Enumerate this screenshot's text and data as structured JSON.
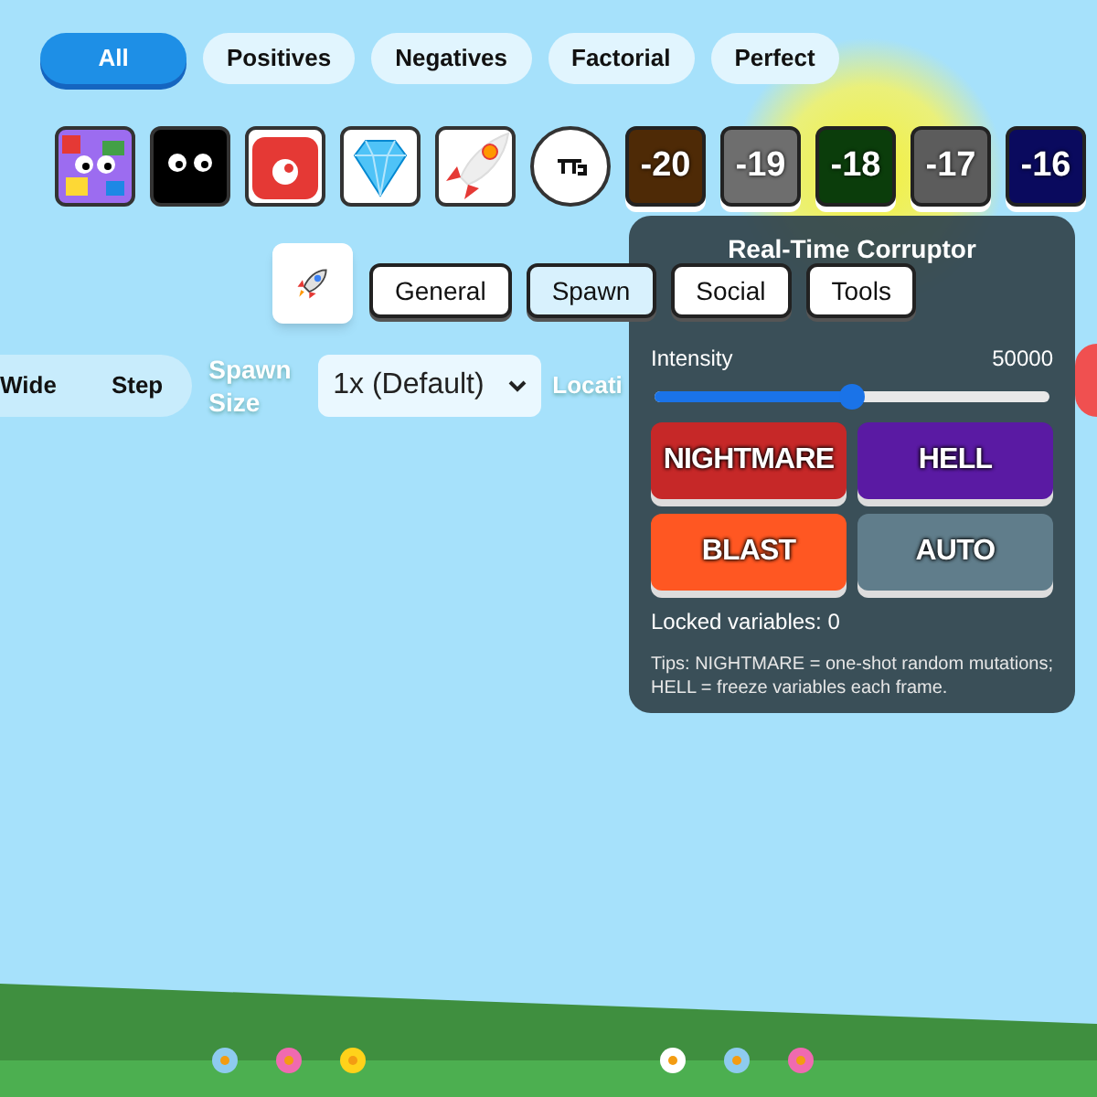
{
  "filters": [
    {
      "label": "All",
      "selected": true
    },
    {
      "label": "Positives",
      "selected": false
    },
    {
      "label": "Negatives",
      "selected": false
    },
    {
      "label": "Factorial",
      "selected": false
    },
    {
      "label": "Perfect",
      "selected": false
    }
  ],
  "items": [
    {
      "kind": "sprite"
    },
    {
      "kind": "sprite"
    },
    {
      "kind": "sprite"
    },
    {
      "kind": "sprite"
    },
    {
      "kind": "sprite"
    },
    {
      "kind": "symbol"
    },
    {
      "kind": "number",
      "label": "-20",
      "color": "#4e2a06"
    },
    {
      "kind": "number",
      "label": "-19",
      "color": "#6e6e6e"
    },
    {
      "kind": "number",
      "label": "-18",
      "color": "#0b3d0b"
    },
    {
      "kind": "number",
      "label": "-17",
      "color": "#5c5c5c"
    },
    {
      "kind": "number",
      "label": "-16",
      "color": "#0a0a5e"
    }
  ],
  "tabs": [
    {
      "label": "General",
      "selected": false
    },
    {
      "label": "Spawn",
      "selected": true
    },
    {
      "label": "Social",
      "selected": false
    },
    {
      "label": "Tools",
      "selected": false
    }
  ],
  "modes": [
    "Wide",
    "Step"
  ],
  "spawn_size": {
    "label": "Spawn Size",
    "value": "1x (Default)"
  },
  "location_label": "Locati",
  "corruptor": {
    "title": "Real-Time Corruptor",
    "intensity": {
      "label": "Intensity",
      "reading": "50000",
      "level": 0.5
    },
    "actions": [
      {
        "label": "NIGHTMARE",
        "color": "#c62828"
      },
      {
        "label": "HELL",
        "color": "#5a1aa3"
      },
      {
        "label": "BLAST",
        "color": "#ff5722"
      },
      {
        "label": "AUTO",
        "color": "#607d8b"
      }
    ],
    "locked": "Locked variables: 0",
    "tips": "Tips: NIGHTMARE = one-shot random mutations; HELL = freeze variables each frame."
  }
}
